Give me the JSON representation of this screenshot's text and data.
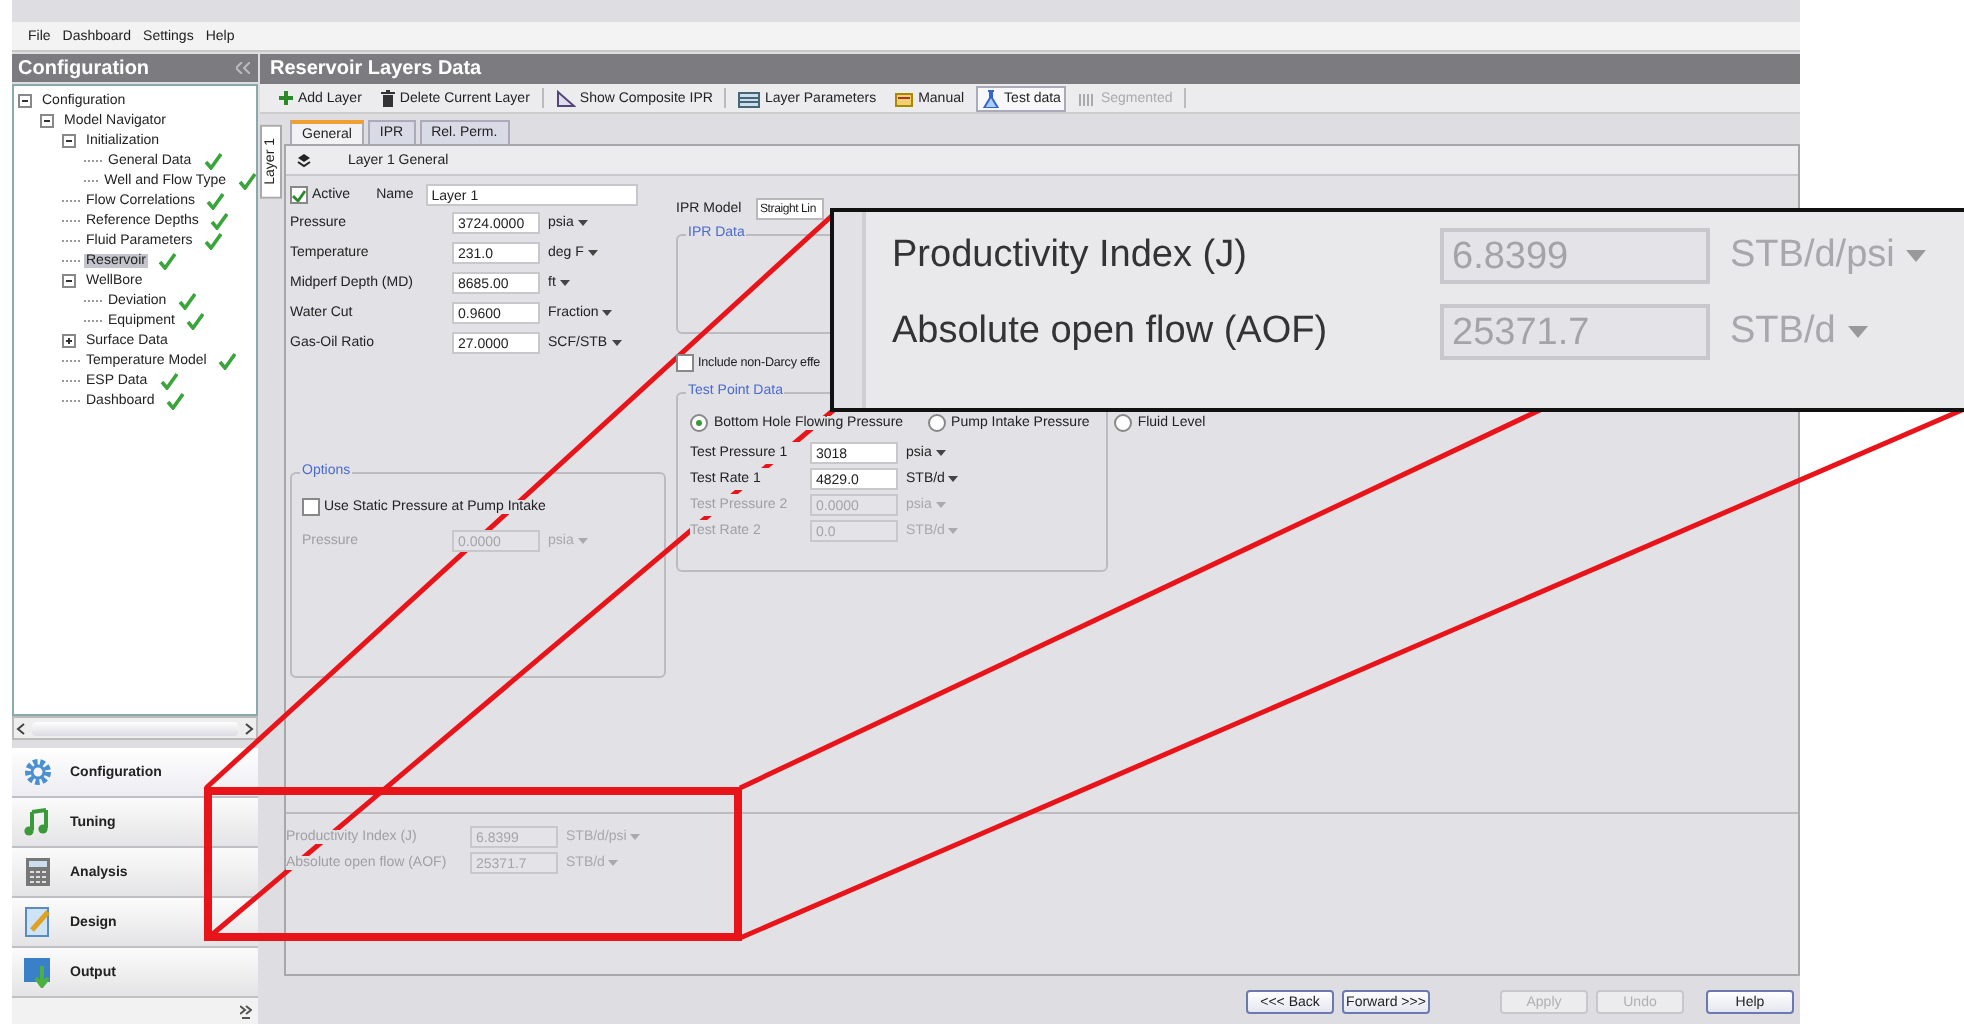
{
  "menu": [
    "File",
    "Dashboard",
    "Settings",
    "Help"
  ],
  "sidebar": {
    "title": "Configuration",
    "tree": [
      {
        "label": "Configuration",
        "expanded": true,
        "children": [
          {
            "label": "Model Navigator",
            "expanded": true,
            "children": [
              {
                "label": "Initialization",
                "expanded": true,
                "children": [
                  {
                    "label": "General Data",
                    "done": true,
                    "selected": false
                  },
                  {
                    "label": "Well and Flow Type",
                    "done": true,
                    "selected": false
                  }
                ]
              },
              {
                "label": "Flow Correlations",
                "done": true,
                "selected": false
              },
              {
                "label": "Reference Depths",
                "done": true,
                "selected": false
              },
              {
                "label": "Fluid Parameters",
                "done": true,
                "selected": false
              },
              {
                "label": "Reservoir",
                "done": true,
                "selected": true
              },
              {
                "label": "WellBore",
                "expanded": true,
                "children": [
                  {
                    "label": "Deviation",
                    "done": true,
                    "selected": false
                  },
                  {
                    "label": "Equipment",
                    "done": true,
                    "selected": false
                  }
                ]
              },
              {
                "label": "Surface Data",
                "expanded": false,
                "done": false,
                "selected": false
              },
              {
                "label": "Temperature Model",
                "done": true,
                "selected": false
              },
              {
                "label": "ESP Data",
                "done": true,
                "selected": false
              },
              {
                "label": "Dashboard",
                "done": true,
                "selected": false
              }
            ]
          }
        ]
      }
    ],
    "nav": [
      {
        "label": "Configuration",
        "kind": "gear",
        "selected": true
      },
      {
        "label": "Tuning",
        "kind": "note",
        "selected": false
      },
      {
        "label": "Analysis",
        "kind": "calculator",
        "selected": false
      },
      {
        "label": "Design",
        "kind": "pencil",
        "selected": false
      },
      {
        "label": "Output",
        "kind": "export",
        "selected": false
      }
    ]
  },
  "main": {
    "title": "Reservoir Layers Data",
    "toolbar": [
      {
        "label": "Add Layer",
        "kind": "plus",
        "selected": false,
        "disabled": false
      },
      {
        "label": "Delete Current Layer",
        "kind": "trash",
        "selected": false,
        "disabled": false
      },
      {
        "label": "Show Composite IPR",
        "kind": "chart",
        "selected": false,
        "disabled": false
      },
      {
        "label": "Layer Parameters",
        "kind": "table",
        "selected": false,
        "disabled": false
      },
      {
        "label": "Manual",
        "kind": "book",
        "selected": false,
        "disabled": false
      },
      {
        "label": "Test data",
        "kind": "flask",
        "selected": true,
        "disabled": false
      },
      {
        "label": "Segmented",
        "kind": "bars",
        "selected": false,
        "disabled": true
      }
    ],
    "layer_tabs": [
      {
        "label": "Layer 1",
        "selected": true
      }
    ],
    "tabs": [
      {
        "label": "General",
        "selected": true
      },
      {
        "label": "IPR",
        "selected": false
      },
      {
        "label": "Rel. Perm.",
        "selected": false
      }
    ],
    "section_title": "Layer 1 General",
    "active": {
      "label": "Active",
      "checked": true
    },
    "name": {
      "label": "Name",
      "value": "Layer 1"
    },
    "fields": [
      {
        "label": "Pressure",
        "value": "3724.0000",
        "unit": "psia"
      },
      {
        "label": "Temperature",
        "value": "231.0",
        "unit": "deg F"
      },
      {
        "label": "Midperf Depth (MD)",
        "value": "8685.00",
        "unit": "ft"
      },
      {
        "label": "Water Cut",
        "value": "0.9600",
        "unit": "Fraction"
      },
      {
        "label": "Gas-Oil Ratio",
        "value": "27.0000",
        "unit": "SCF/STB"
      }
    ],
    "ipr_model": {
      "label": "IPR Model",
      "value": "Straight Lin"
    },
    "ipr_data": {
      "title": "IPR Data"
    },
    "non_darcy": {
      "label": "Include non-Darcy effe",
      "checked": false
    },
    "test_point": {
      "title": "Test Point Data",
      "options": [
        {
          "label": "Bottom Hole Flowing Pressure",
          "selected": true
        },
        {
          "label": "Pump Intake Pressure",
          "selected": false
        },
        {
          "label": "Fluid Level",
          "selected": false
        }
      ],
      "rows": [
        {
          "label": "Test Pressure 1",
          "value": "3018",
          "unit": "psia",
          "disabled": false
        },
        {
          "label": "Test Rate 1",
          "value": "4829.0",
          "unit": "STB/d",
          "disabled": false
        },
        {
          "label": "Test Pressure 2",
          "value": "0.0000",
          "unit": "psia",
          "disabled": true
        },
        {
          "label": "Test Rate 2",
          "value": "0.0",
          "unit": "STB/d",
          "disabled": true
        }
      ]
    },
    "options": {
      "title": "Options",
      "checkbox": {
        "label": "Use Static Pressure at Pump Intake",
        "checked": false
      },
      "pressure": {
        "label": "Pressure",
        "value": "0.0000",
        "unit": "psia",
        "disabled": true
      }
    },
    "results": [
      {
        "label": "Productivity Index (J)",
        "value": "6.8399",
        "unit": "STB/d/psi",
        "disabled": true
      },
      {
        "label": "Absolute open flow (AOF)",
        "value": "25371.7",
        "unit": "STB/d",
        "disabled": true
      }
    ],
    "buttons": [
      {
        "label": "<<< Back",
        "disabled": false
      },
      {
        "label": "Forward >>>",
        "disabled": false
      },
      {
        "label": "Apply",
        "disabled": true
      },
      {
        "label": "Undo",
        "disabled": true
      },
      {
        "label": "Help",
        "disabled": false
      }
    ]
  },
  "callout": {
    "rows": [
      {
        "label": "Productivity Index (J)",
        "value": "6.8399",
        "unit": "STB/d/psi",
        "disabled": true
      },
      {
        "label": "Absolute open flow (AOF)",
        "value": "25371.7",
        "unit": "STB/d",
        "disabled": true
      }
    ]
  }
}
